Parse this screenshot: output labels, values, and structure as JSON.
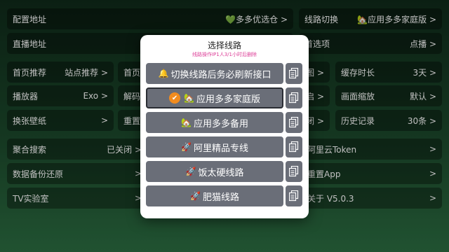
{
  "settings": {
    "row1": {
      "config_label": "配置地址",
      "config_value": "💚多多优选仓",
      "route_label": "线路切换",
      "route_value": "🏡应用多多家庭版"
    },
    "row2": {
      "live_label": "直播地址",
      "home_pref_partial": "首选项",
      "home_pref_value": "点播"
    },
    "row3": {
      "home_rec_label": "首页推荐",
      "home_rec_value": "站点推荐",
      "partial_a": "首页",
      "partial_b": "图",
      "cache_label": "缓存时长",
      "cache_value": "3天"
    },
    "row4": {
      "player_label": "播放器",
      "player_value": "Exo",
      "partial_a": "解码",
      "partial_b": "启",
      "zoom_label": "画面缩放",
      "zoom_value": "默认"
    },
    "row5": {
      "wallpaper_label": "换张壁纸",
      "partial_a": "重置",
      "partial_b": "闭",
      "history_label": "历史记录",
      "history_value": "30条"
    },
    "row6": {
      "agg_label": "聚合搜索",
      "agg_value": "已关闭",
      "aliyun_label": "阿里云Token"
    },
    "row7": {
      "backup_label": "数据备份还原",
      "reset_label": "重置App"
    },
    "row8": {
      "tvlab_label": "TV实验室",
      "about_label": "关于 V5.0.3"
    }
  },
  "dialog": {
    "title": "选择线路",
    "subtitle": "线路操作IP1人3/1小时后删除",
    "routes": [
      {
        "icon": "🔔",
        "label": "切换线路后务必刷新接口",
        "selected": false
      },
      {
        "icon": "🏡",
        "label": "应用多多家庭版",
        "selected": true
      },
      {
        "icon": "🏡",
        "label": "应用多多备用",
        "selected": false
      },
      {
        "icon": "🚀",
        "label": "阿里精品专线",
        "selected": false
      },
      {
        "icon": "🚀",
        "label": "饭太硬线路",
        "selected": false
      },
      {
        "icon": "🚀",
        "label": "肥猫线路",
        "selected": false
      }
    ],
    "check_mark": "✔"
  },
  "colors": {
    "route_bg": "#6a6e78",
    "selected_check": "#f28c1e",
    "subtitle": "#d9298c"
  },
  "icons": {
    "copy": "copy-icon",
    "check": "check-circle-icon"
  }
}
